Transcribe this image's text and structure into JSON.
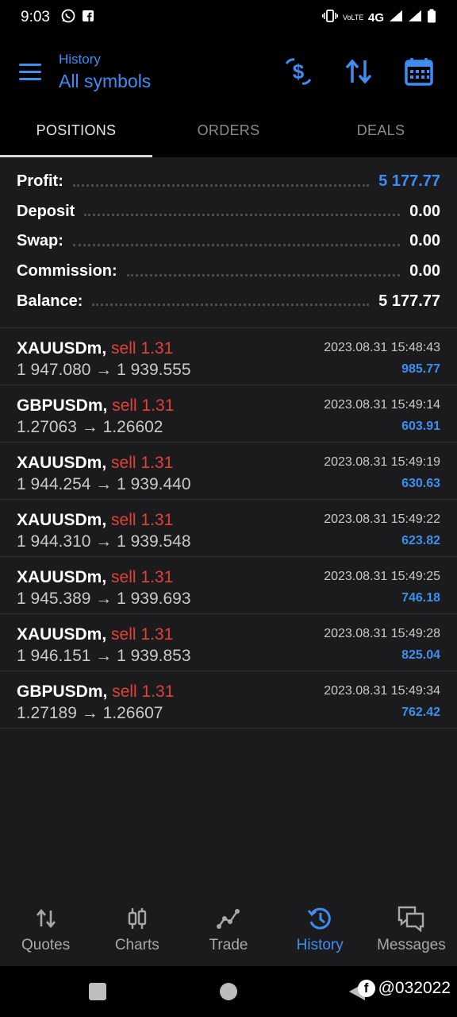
{
  "status_bar": {
    "time": "9:03",
    "network": "4G",
    "volte": "VoLTE"
  },
  "header": {
    "subtitle": "History",
    "title": "All symbols"
  },
  "tabs": [
    {
      "label": "POSITIONS",
      "active": true
    },
    {
      "label": "ORDERS",
      "active": false
    },
    {
      "label": "DEALS",
      "active": false
    }
  ],
  "summary": [
    {
      "label": "Profit:",
      "value": "5 177.77"
    },
    {
      "label": "Deposit",
      "value": "0.00"
    },
    {
      "label": "Swap:",
      "value": "0.00"
    },
    {
      "label": "Commission:",
      "value": "0.00"
    },
    {
      "label": "Balance:",
      "value": "5 177.77"
    }
  ],
  "deals": [
    {
      "symbol": "XAUUSDm,",
      "side": "sell 1.31",
      "prices": "1 947.080 → 1 939.555",
      "time": "2023.08.31 15:48:43",
      "profit": "985.77"
    },
    {
      "symbol": "GBPUSDm,",
      "side": "sell 1.31",
      "prices": "1.27063 → 1.26602",
      "time": "2023.08.31 15:49:14",
      "profit": "603.91"
    },
    {
      "symbol": "XAUUSDm,",
      "side": "sell 1.31",
      "prices": "1 944.254 → 1 939.440",
      "time": "2023.08.31 15:49:19",
      "profit": "630.63"
    },
    {
      "symbol": "XAUUSDm,",
      "side": "sell 1.31",
      "prices": "1 944.310 → 1 939.548",
      "time": "2023.08.31 15:49:22",
      "profit": "623.82"
    },
    {
      "symbol": "XAUUSDm,",
      "side": "sell 1.31",
      "prices": "1 945.389 → 1 939.693",
      "time": "2023.08.31 15:49:25",
      "profit": "746.18"
    },
    {
      "symbol": "XAUUSDm,",
      "side": "sell 1.31",
      "prices": "1 946.151 → 1 939.853",
      "time": "2023.08.31 15:49:28",
      "profit": "825.04"
    },
    {
      "symbol": "GBPUSDm,",
      "side": "sell 1.31",
      "prices": "1.27189 → 1.26607",
      "time": "2023.08.31 15:49:34",
      "profit": "762.42"
    }
  ],
  "bottom_nav": [
    {
      "label": "Quotes",
      "icon": "quotes-icon",
      "active": false
    },
    {
      "label": "Charts",
      "icon": "charts-icon",
      "active": false
    },
    {
      "label": "Trade",
      "icon": "trade-icon",
      "active": false
    },
    {
      "label": "History",
      "icon": "history-icon",
      "active": true
    },
    {
      "label": "Messages",
      "icon": "messages-icon",
      "active": false
    }
  ],
  "watermark": {
    "text": "@032022"
  },
  "colors": {
    "accent": "#3d8ef0",
    "sell": "#e0413a",
    "panel": "#1b1b1d"
  }
}
